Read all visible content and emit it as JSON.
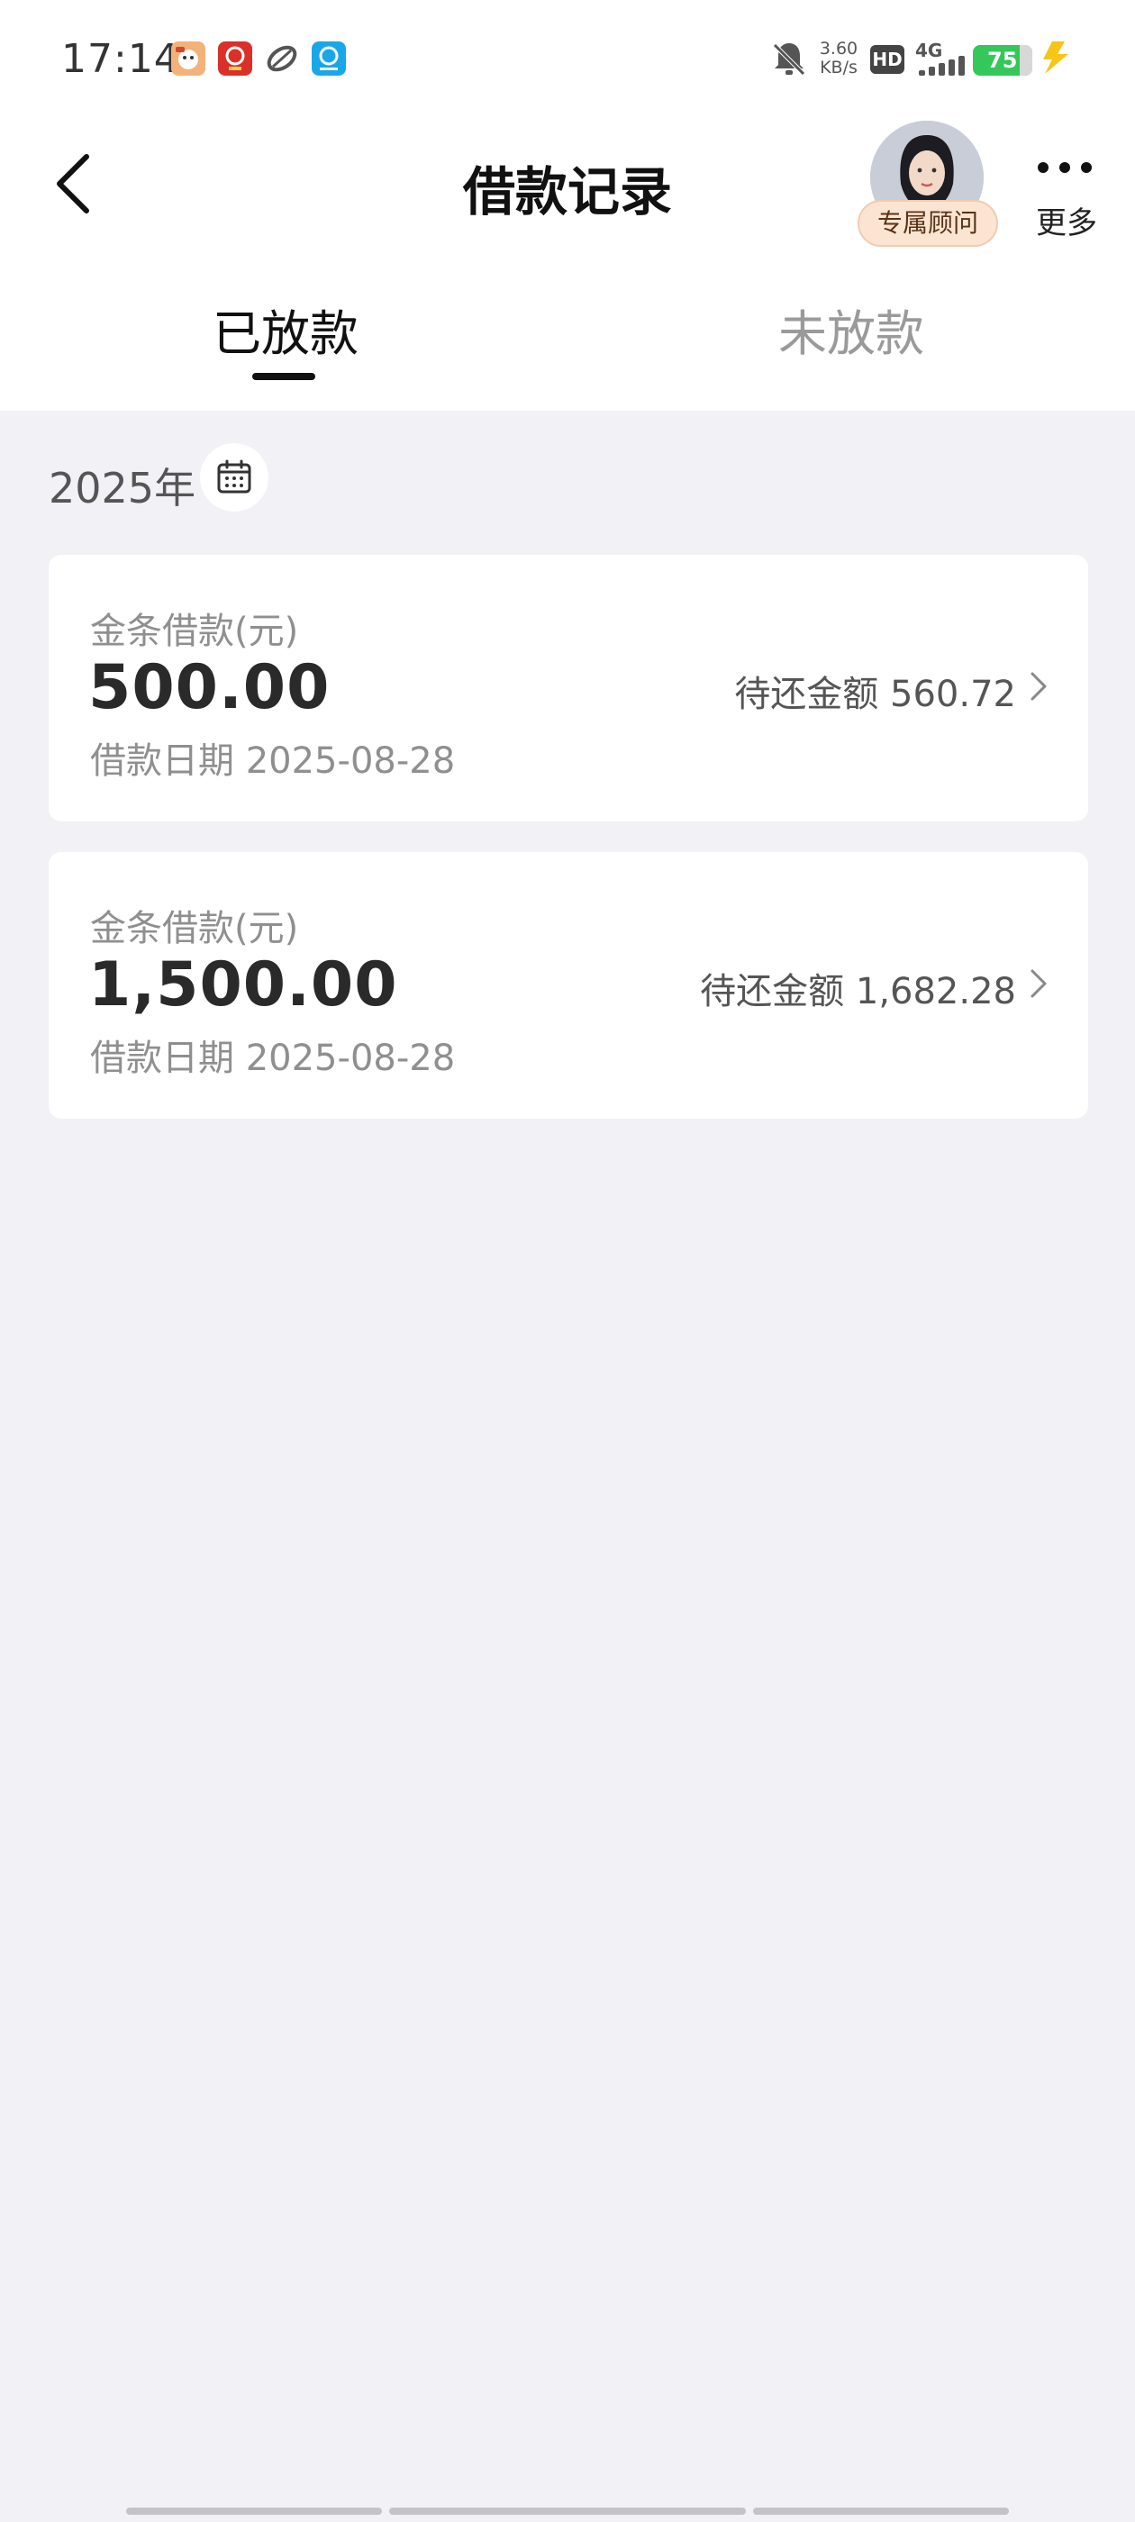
{
  "status_bar": {
    "time": "17:14",
    "net_speed_value": "3.60",
    "net_speed_unit": "KB/s",
    "hd_label": "HD",
    "network_label": "4G",
    "battery_level": "75",
    "colors": {
      "battery": "#34c759",
      "charging": "#f5c518"
    },
    "app_icons": [
      "app-icon-1",
      "app-icon-2",
      "app-icon-3",
      "app-icon-4"
    ],
    "silent_icon": "bell-off-icon"
  },
  "header": {
    "title": "借款记录",
    "advisor_label": "专属顾问",
    "more_label": "更多"
  },
  "tabs": [
    {
      "label": "已放款",
      "active": true
    },
    {
      "label": "未放款",
      "active": false
    }
  ],
  "filter": {
    "year_label": "2025年",
    "calendar_icon": "calendar-icon"
  },
  "loans": [
    {
      "type_label": "金条借款(元)",
      "amount": "500.00",
      "date_label": "借款日期 2025-08-28",
      "pending_label": "待还金额 560.72"
    },
    {
      "type_label": "金条借款(元)",
      "amount": "1,500.00",
      "date_label": "借款日期 2025-08-28",
      "pending_label": "待还金额 1,682.28"
    }
  ]
}
